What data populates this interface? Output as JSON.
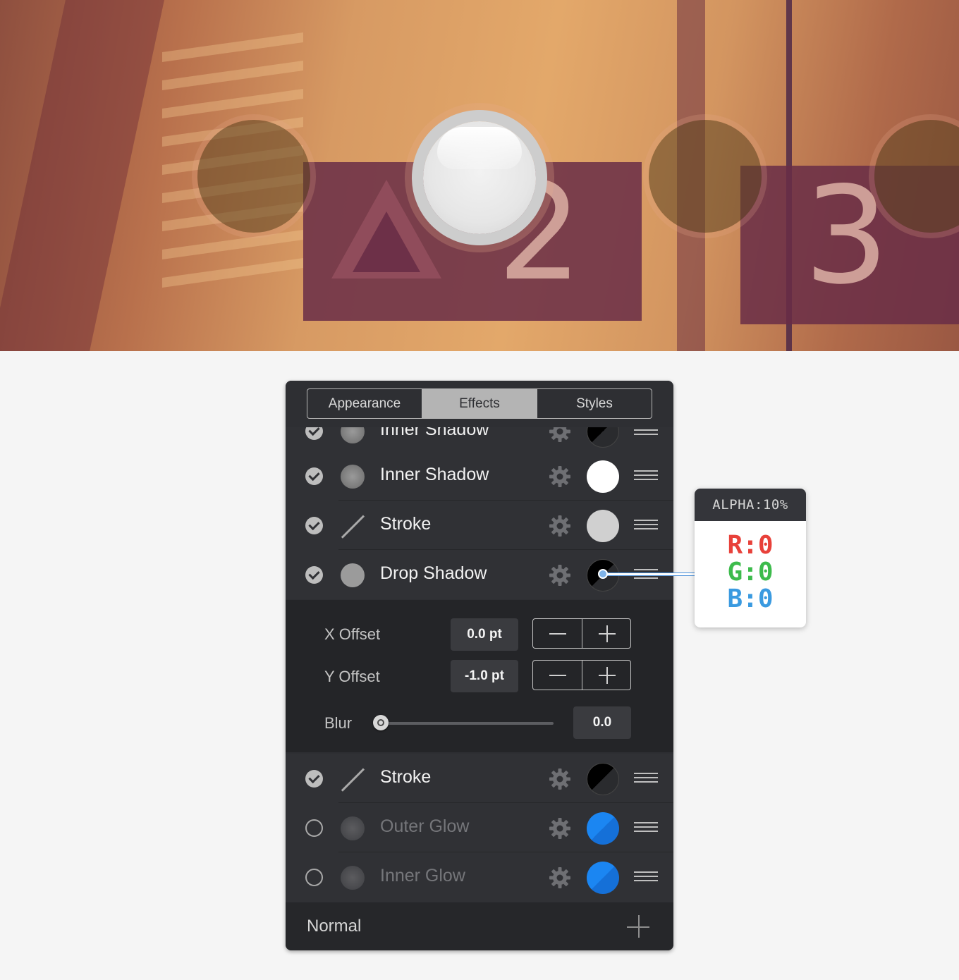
{
  "tabs": [
    {
      "label": "Appearance",
      "active": false
    },
    {
      "label": "Effects",
      "active": true
    },
    {
      "label": "Styles",
      "active": false
    }
  ],
  "effects": [
    {
      "label": "Inner Shadow",
      "enabled": true,
      "icon": "shadow-icon",
      "color": "#1a1a1a"
    },
    {
      "label": "Inner Shadow",
      "enabled": true,
      "icon": "shadow-icon",
      "color": "#ffffff"
    },
    {
      "label": "Stroke",
      "enabled": true,
      "icon": "stroke-icon",
      "color": "#d0d0d0"
    },
    {
      "label": "Drop Shadow",
      "enabled": true,
      "icon": "shadow-icon",
      "color": "#000000"
    },
    {
      "label": "Stroke",
      "enabled": true,
      "icon": "stroke-icon",
      "color": "#000000"
    },
    {
      "label": "Outer Glow",
      "enabled": false,
      "icon": "glow-icon",
      "color": "#1b86f2"
    },
    {
      "label": "Inner Glow",
      "enabled": false,
      "icon": "glow-icon",
      "color": "#1b86f2"
    }
  ],
  "detail": {
    "x_offset_label": "X Offset",
    "x_offset_value": "0.0 pt",
    "y_offset_label": "Y Offset",
    "y_offset_value": "-1.0 pt",
    "blur_label": "Blur",
    "blur_value": "0.0",
    "blur_fraction": 0.0
  },
  "footer": {
    "blend_mode": "Normal"
  },
  "callout": {
    "header": "ALPHA:10%",
    "r": "R:0",
    "g": "G:0",
    "b": "B:0"
  },
  "banner": {
    "numbers": [
      "2",
      "3"
    ]
  },
  "colors": {
    "panel_bg": "#2e2f33",
    "accent_blue": "#1b86f2",
    "red": "#e8413a",
    "green": "#3dbb4c",
    "blue": "#3a9ae0"
  }
}
